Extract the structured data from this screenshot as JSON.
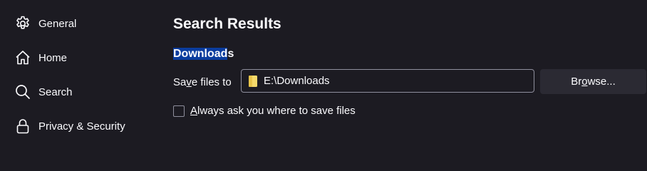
{
  "sidebar": {
    "items": [
      {
        "label": "General",
        "icon": "gear-icon"
      },
      {
        "label": "Home",
        "icon": "home-icon"
      },
      {
        "label": "Search",
        "icon": "search-icon"
      },
      {
        "label": "Privacy & Security",
        "icon": "lock-icon"
      }
    ]
  },
  "main": {
    "title": "Search Results",
    "downloads": {
      "heading_highlighted": "Download",
      "heading_rest": "s",
      "save_label_pre": "Sa",
      "save_label_key": "v",
      "save_label_post": "e files to",
      "path": "E:\\Downloads",
      "folder_icon": "folder-icon",
      "browse_pre": "Br",
      "browse_key": "o",
      "browse_post": "wse...",
      "ask_checked": false,
      "ask_key": "A",
      "ask_rest": "lways ask you where to save files"
    }
  },
  "colors": {
    "background": "#1c1b22",
    "text": "#fbfbfe",
    "highlight": "#0a3c9e",
    "button": "#2b2a33",
    "border": "#8f8f9d",
    "folder": "#f5d96b"
  }
}
